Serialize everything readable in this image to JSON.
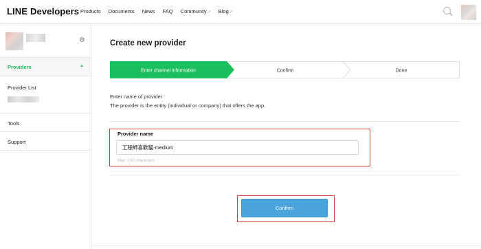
{
  "header": {
    "logo_line": "LINE",
    "logo_dev": "Developers",
    "nav": [
      {
        "label": "Products",
        "external": false
      },
      {
        "label": "Documents",
        "external": false
      },
      {
        "label": "News",
        "external": false
      },
      {
        "label": "FAQ",
        "external": false
      },
      {
        "label": "Community",
        "external": true
      },
      {
        "label": "Blog",
        "external": true
      }
    ],
    "external_glyph": "↗",
    "search_icon": "search-icon"
  },
  "sidebar": {
    "settings_icon": "gear-icon",
    "providers_label": "Providers",
    "provider_list_label": "Provider List",
    "tools_label": "Tools",
    "support_label": "Support"
  },
  "main": {
    "title": "Create new provider",
    "steps": [
      {
        "label": "Enter channel information",
        "active": true
      },
      {
        "label": "Confirm",
        "active": false
      },
      {
        "label": "Done",
        "active": false
      }
    ],
    "description_line1": "Enter name of provider",
    "description_line2": "The provider is the entity (individual or company) that offers the app.",
    "field_label": "Provider name",
    "field_value": "工程師喜歡貓-medium",
    "field_hint": "Max: 100 characters",
    "confirm_label": "Confirm"
  },
  "colors": {
    "accent_green": "#1cbf5d",
    "button_blue": "#4ba3dc",
    "highlight_red": "#d93a3a"
  }
}
